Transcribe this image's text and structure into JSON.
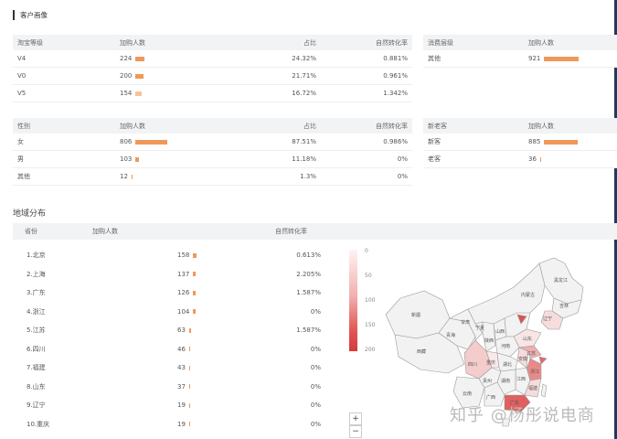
{
  "title": "客户画像",
  "colors": {
    "bar": "#f0985a",
    "bar_light": "#f6c39b",
    "map_base": "#f2f2f2",
    "map_border": "#9b9b9b",
    "map_dark": "#d9534f"
  },
  "vip_table": {
    "headers": [
      "淘宝等级",
      "加购人数",
      "占比",
      "自然转化率"
    ],
    "rows": [
      {
        "label": "V4",
        "count": "224",
        "pct": "24.32%",
        "rate": "0.881%",
        "bar": 0.243
      },
      {
        "label": "V0",
        "count": "200",
        "pct": "21.71%",
        "rate": "0.961%",
        "bar": 0.217
      },
      {
        "label": "V5",
        "count": "154",
        "pct": "16.72%",
        "rate": "1.342%",
        "bar": 0.167
      }
    ]
  },
  "consume_table": {
    "headers": [
      "消费层级",
      "加购人数"
    ],
    "rows": [
      {
        "label": "其他",
        "count": "921",
        "bar": 1.0
      }
    ]
  },
  "gender_table": {
    "headers": [
      "性别",
      "加购人数",
      "占比",
      "自然转化率"
    ],
    "rows": [
      {
        "label": "女",
        "count": "806",
        "pct": "87.51%",
        "rate": "0.986%",
        "bar": 0.875
      },
      {
        "label": "男",
        "count": "103",
        "pct": "11.18%",
        "rate": "0%",
        "bar": 0.112
      },
      {
        "label": "其他",
        "count": "12",
        "pct": "1.3%",
        "rate": "0%",
        "bar": 0.013
      }
    ]
  },
  "newold_table": {
    "headers": [
      "新老客",
      "加购人数"
    ],
    "rows": [
      {
        "label": "新客",
        "count": "885",
        "bar": 0.961
      },
      {
        "label": "老客",
        "count": "36",
        "bar": 0.039
      }
    ]
  },
  "region": {
    "title": "地域分布",
    "headers": [
      "省份",
      "加购人数",
      "自然转化率"
    ],
    "rows": [
      {
        "label": "1.北京",
        "count": "158",
        "rate": "0.613%",
        "bar": 1.0
      },
      {
        "label": "2.上海",
        "count": "137",
        "rate": "2.205%",
        "bar": 0.867
      },
      {
        "label": "3.广东",
        "count": "126",
        "rate": "1.587%",
        "bar": 0.797
      },
      {
        "label": "4.浙江",
        "count": "104",
        "rate": "0%",
        "bar": 0.658
      },
      {
        "label": "5.江苏",
        "count": "63",
        "rate": "1.587%",
        "bar": 0.399
      },
      {
        "label": "6.四川",
        "count": "46",
        "rate": "0%",
        "bar": 0.291
      },
      {
        "label": "7.福建",
        "count": "43",
        "rate": "0%",
        "bar": 0.272
      },
      {
        "label": "8.山东",
        "count": "37",
        "rate": "0%",
        "bar": 0.234
      },
      {
        "label": "9.辽宁",
        "count": "19",
        "rate": "0%",
        "bar": 0.12
      },
      {
        "label": "10.重庆",
        "count": "19",
        "rate": "0%",
        "bar": 0.12
      }
    ],
    "legend": [
      "0",
      "50",
      "100",
      "150",
      "200"
    ],
    "zoom_in": "+",
    "zoom_out": "−"
  },
  "map_labels": [
    "黑龙江",
    "吉林",
    "辽宁",
    "新疆",
    "西藏",
    "青海",
    "甘肃",
    "内蒙古",
    "四川",
    "重庆",
    "湖北",
    "湖南",
    "广西",
    "广东",
    "福建",
    "浙江",
    "江苏",
    "安徽",
    "江西",
    "贵州",
    "云南",
    "河南",
    "山东",
    "山西",
    "陕西",
    "宁夏"
  ],
  "watermark": "知乎 @杨彤说电商"
}
